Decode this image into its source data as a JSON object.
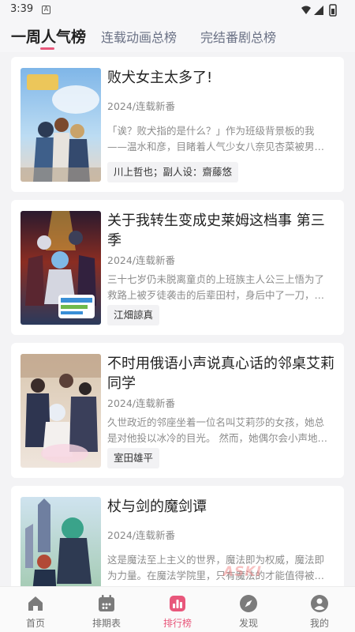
{
  "status": {
    "time": "3:39",
    "indicator": "A"
  },
  "tabs": [
    {
      "label": "一周人气榜",
      "active": true
    },
    {
      "label": "连载动画总榜",
      "active": false
    },
    {
      "label": "完结番剧总榜",
      "active": false
    }
  ],
  "cards": [
    {
      "title": "败犬女主太多了!",
      "meta": "2024/连载新番",
      "desc_line1": "「诶？败犬指的是什么？」作为班级背景板的我",
      "desc_line2": "——温水和彦，目睹着人气少女八奈见杏菜被男…",
      "tag": "川上哲也；副人设：齋藤悠"
    },
    {
      "title": "关于我转生变成史莱姆这档事 第三季",
      "meta": "2024/连载新番",
      "desc_line1": "三十七岁仍未脱离童贞的上班族主人公三上悟为了",
      "desc_line2": "救路上被歹徒袭击的后辈田村，身后中了一刀，…",
      "tag": "江畑諒真"
    },
    {
      "title": "不时用俄语小声说真心话的邻桌艾莉同学",
      "meta": "2024/连载新番",
      "desc_line1": "久世政近的邻座坐着一位名叫艾莉莎的女孩，她总",
      "desc_line2": "是对他投以冰冷的目光。 然而，她偶尔会小声地…",
      "tag": "室田雄平"
    },
    {
      "title": "杖与剑的魔剑谭",
      "meta": "2024/连载新番",
      "desc_line1": "这是魔法至上主义的世界，魔法即为权威，魔法即",
      "desc_line2": "为力量。在魔法学院里，只有魔法的才能值得被…",
      "tag": ""
    }
  ],
  "bottom_nav": [
    {
      "label": "首页",
      "icon": "home-icon",
      "active": false
    },
    {
      "label": "排期表",
      "icon": "calendar-icon",
      "active": false
    },
    {
      "label": "排行榜",
      "icon": "ranking-icon",
      "active": true
    },
    {
      "label": "发现",
      "icon": "compass-icon",
      "active": false
    },
    {
      "label": "我的",
      "icon": "user-icon",
      "active": false
    }
  ],
  "watermark": "ASKI",
  "colors": {
    "accent": "#e8577b",
    "nav_icon": "#7b7b7b",
    "background": "#f3f3f5"
  }
}
